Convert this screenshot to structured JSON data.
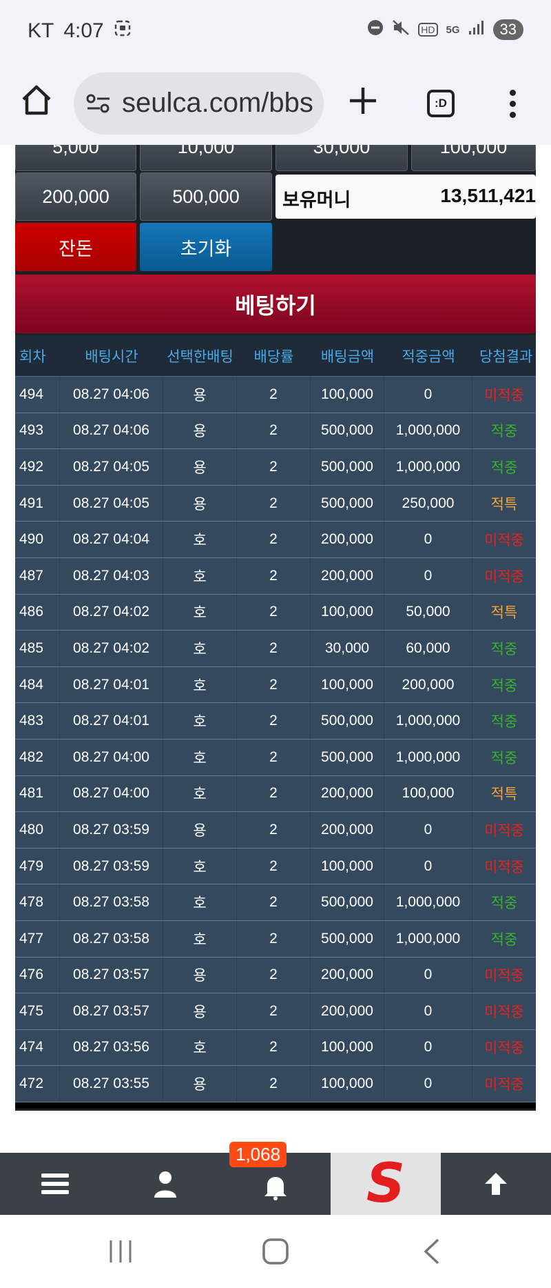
{
  "status_bar": {
    "carrier": "KT",
    "time": "4:07",
    "network": "5G",
    "hd": "HD",
    "battery": "33"
  },
  "browser": {
    "url": "seulca.com/bbs",
    "tab_icon_label": ":D"
  },
  "chips": {
    "row_partial": [
      "5,000",
      "10,000",
      "30,000",
      "100,000"
    ],
    "row2": [
      "200,000",
      "500,000"
    ]
  },
  "money": {
    "label": "보유머니",
    "value": "13,511,421"
  },
  "buttons": {
    "all_in": "잔돈",
    "reset": "초기화",
    "bet": "베팅하기"
  },
  "table": {
    "headers": [
      "회차",
      "배팅시간",
      "선택한배팅",
      "배당률",
      "배팅금액",
      "적중금액",
      "당첨결과"
    ],
    "rows": [
      {
        "round": "494",
        "time": "08.27 04:06",
        "pick": "용",
        "odds": "2",
        "bet": "100,000",
        "win": "0",
        "result": "미적중",
        "status": "miss"
      },
      {
        "round": "493",
        "time": "08.27 04:06",
        "pick": "용",
        "odds": "2",
        "bet": "500,000",
        "win": "1,000,000",
        "result": "적중",
        "status": "hit"
      },
      {
        "round": "492",
        "time": "08.27 04:05",
        "pick": "용",
        "odds": "2",
        "bet": "500,000",
        "win": "1,000,000",
        "result": "적중",
        "status": "hit"
      },
      {
        "round": "491",
        "time": "08.27 04:05",
        "pick": "용",
        "odds": "2",
        "bet": "500,000",
        "win": "250,000",
        "result": "적특",
        "status": "special"
      },
      {
        "round": "490",
        "time": "08.27 04:04",
        "pick": "호",
        "odds": "2",
        "bet": "200,000",
        "win": "0",
        "result": "미적중",
        "status": "miss"
      },
      {
        "round": "487",
        "time": "08.27 04:03",
        "pick": "호",
        "odds": "2",
        "bet": "200,000",
        "win": "0",
        "result": "미적중",
        "status": "miss"
      },
      {
        "round": "486",
        "time": "08.27 04:02",
        "pick": "호",
        "odds": "2",
        "bet": "100,000",
        "win": "50,000",
        "result": "적특",
        "status": "special"
      },
      {
        "round": "485",
        "time": "08.27 04:02",
        "pick": "호",
        "odds": "2",
        "bet": "30,000",
        "win": "60,000",
        "result": "적중",
        "status": "hit"
      },
      {
        "round": "484",
        "time": "08.27 04:01",
        "pick": "호",
        "odds": "2",
        "bet": "100,000",
        "win": "200,000",
        "result": "적중",
        "status": "hit"
      },
      {
        "round": "483",
        "time": "08.27 04:01",
        "pick": "호",
        "odds": "2",
        "bet": "500,000",
        "win": "1,000,000",
        "result": "적중",
        "status": "hit"
      },
      {
        "round": "482",
        "time": "08.27 04:00",
        "pick": "호",
        "odds": "2",
        "bet": "500,000",
        "win": "1,000,000",
        "result": "적중",
        "status": "hit"
      },
      {
        "round": "481",
        "time": "08.27 04:00",
        "pick": "호",
        "odds": "2",
        "bet": "200,000",
        "win": "100,000",
        "result": "적특",
        "status": "special"
      },
      {
        "round": "480",
        "time": "08.27 03:59",
        "pick": "용",
        "odds": "2",
        "bet": "200,000",
        "win": "0",
        "result": "미적중",
        "status": "miss"
      },
      {
        "round": "479",
        "time": "08.27 03:59",
        "pick": "호",
        "odds": "2",
        "bet": "100,000",
        "win": "0",
        "result": "미적중",
        "status": "miss"
      },
      {
        "round": "478",
        "time": "08.27 03:58",
        "pick": "호",
        "odds": "2",
        "bet": "500,000",
        "win": "1,000,000",
        "result": "적중",
        "status": "hit"
      },
      {
        "round": "477",
        "time": "08.27 03:58",
        "pick": "호",
        "odds": "2",
        "bet": "500,000",
        "win": "1,000,000",
        "result": "적중",
        "status": "hit"
      },
      {
        "round": "476",
        "time": "08.27 03:57",
        "pick": "용",
        "odds": "2",
        "bet": "200,000",
        "win": "0",
        "result": "미적중",
        "status": "miss"
      },
      {
        "round": "475",
        "time": "08.27 03:57",
        "pick": "용",
        "odds": "2",
        "bet": "200,000",
        "win": "0",
        "result": "미적중",
        "status": "miss"
      },
      {
        "round": "474",
        "time": "08.27 03:56",
        "pick": "호",
        "odds": "2",
        "bet": "100,000",
        "win": "0",
        "result": "미적중",
        "status": "miss"
      },
      {
        "round": "472",
        "time": "08.27 03:55",
        "pick": "용",
        "odds": "2",
        "bet": "100,000",
        "win": "0",
        "result": "미적중",
        "status": "miss"
      }
    ]
  },
  "bottom_nav": {
    "notification_count": "1,068",
    "logo_letter": "S"
  },
  "colors": {
    "miss": "#e6231e",
    "hit": "#3bb12e",
    "special": "#f4a43a",
    "header_text": "#4aa8e6",
    "row_bg": "#34495e"
  }
}
